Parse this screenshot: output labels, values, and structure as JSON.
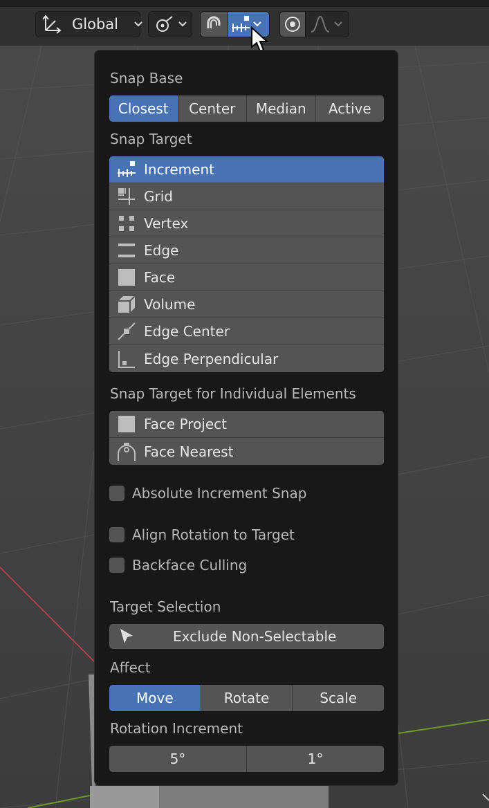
{
  "header": {
    "orientation": {
      "label": "Global",
      "icon": "transform-orientation-icon"
    },
    "pivot": {
      "icon": "pivot-point-icon"
    },
    "snap": {
      "toggle_icon": "magnet-icon",
      "target_icon": "increment-icon"
    },
    "proportional": {
      "toggle_icon": "proportional-edit-icon",
      "falloff_icon": "falloff-curve-icon"
    }
  },
  "popover": {
    "snap_base": {
      "label": "Snap Base",
      "options": [
        "Closest",
        "Center",
        "Median",
        "Active"
      ],
      "selected": "Closest"
    },
    "snap_target": {
      "label": "Snap Target",
      "items": [
        {
          "label": "Increment",
          "icon": "increment-icon",
          "active": true
        },
        {
          "label": "Grid",
          "icon": "grid-icon",
          "active": false
        },
        {
          "label": "Vertex",
          "icon": "vertex-icon",
          "active": false
        },
        {
          "label": "Edge",
          "icon": "edge-icon",
          "active": false
        },
        {
          "label": "Face",
          "icon": "face-icon",
          "active": false
        },
        {
          "label": "Volume",
          "icon": "volume-icon",
          "active": false
        },
        {
          "label": "Edge Center",
          "icon": "edge-center-icon",
          "active": false
        },
        {
          "label": "Edge Perpendicular",
          "icon": "edge-perpendicular-icon",
          "active": false
        }
      ]
    },
    "individual": {
      "label": "Snap Target for Individual Elements",
      "items": [
        {
          "label": "Face Project",
          "icon": "face-project-icon"
        },
        {
          "label": "Face Nearest",
          "icon": "face-nearest-icon"
        }
      ]
    },
    "checkboxes": {
      "absolute_increment": {
        "label": "Absolute Increment Snap",
        "checked": false
      },
      "align_rotation": {
        "label": "Align Rotation to Target",
        "checked": false
      },
      "backface_culling": {
        "label": "Backface Culling",
        "checked": false
      }
    },
    "target_selection": {
      "label": "Target Selection",
      "button_label": "Exclude Non-Selectable",
      "icon": "cursor-arrow-icon"
    },
    "affect": {
      "label": "Affect",
      "options": [
        "Move",
        "Rotate",
        "Scale"
      ],
      "selected": "Move"
    },
    "rotation_increment": {
      "label": "Rotation Increment",
      "values": [
        "5°",
        "1°"
      ]
    }
  },
  "colors": {
    "accent": "#4772b3",
    "button": "#545454",
    "panel": "#181818",
    "header": "#303030"
  }
}
